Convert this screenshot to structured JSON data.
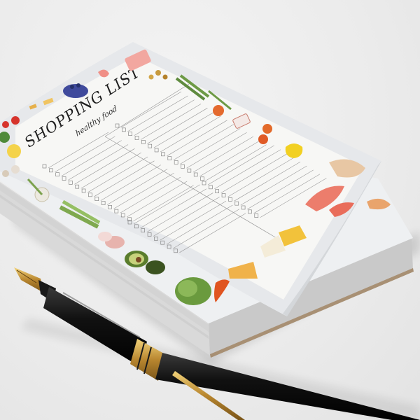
{
  "notepad": {
    "title": "SHOPPING LIST",
    "subtitle": "healthy food"
  },
  "colors": {
    "background": "#ececec",
    "paper": "#f6f6f4",
    "border": "#e4e5e8",
    "pen_body": "#1a1a1a",
    "pen_gold": "#c9a14a"
  },
  "icons": [
    "tomato-icon",
    "pasta-icon",
    "blueberry-bowl-icon",
    "shrimp-icon",
    "tray-icon",
    "nuts-icon",
    "asparagus-icon",
    "orange-icon",
    "bacon-icon",
    "pepper-icon",
    "salmon-icon",
    "bread-icon",
    "cheese-icon",
    "chili-icon",
    "lettuce-icon",
    "avocado-icon",
    "meat-icon",
    "celery-icon",
    "onion-icon",
    "mushroom-icon",
    "lemon-icon",
    "broccoli-icon"
  ]
}
